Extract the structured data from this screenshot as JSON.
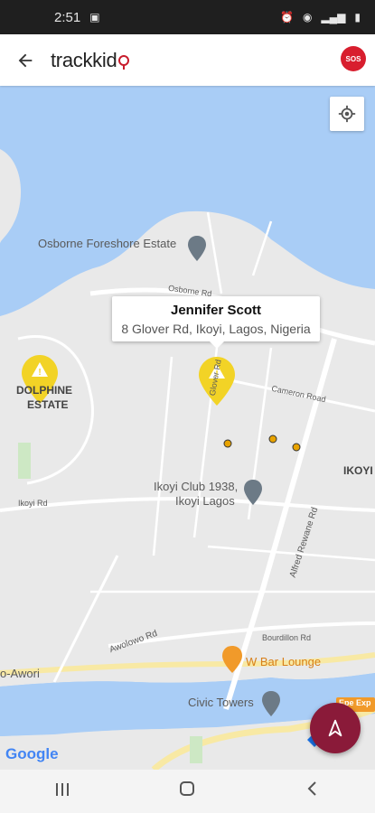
{
  "status_bar": {
    "time": "2:51"
  },
  "app_bar": {
    "logo_text": "trackkid",
    "sos_label": "SOS"
  },
  "map": {
    "labels": {
      "osborne": "Osborne Foreshore Estate",
      "dolphine_1": "DOLPHINE",
      "dolphine_2": "ESTATE",
      "ikoyi": "IKOYI",
      "ikoyi_club_1": "Ikoyi Club 1938,",
      "ikoyi_club_2": "Ikoyi Lagos",
      "wbar": "W Bar Lounge",
      "civic": "Civic Towers",
      "awori": "o-Awori",
      "alfred": "Alfred Rewane Rd",
      "cameron": "Cameron Road",
      "glover": "Glover Rd",
      "awolowo": "Awolowo Rd",
      "bourdillon": "Bourdillon Rd",
      "osborne_rd": "Osborne Rd",
      "ikoyi_rd": "Ikoyi Rd",
      "epe": "Epe Exp"
    },
    "info_window": {
      "name": "Jennifer Scott",
      "address": "8 Glover Rd, Ikoyi, Lagos, Nigeria"
    },
    "google_logo": "Google"
  },
  "colors": {
    "water": "#a9cdf6",
    "land": "#e9e9e9",
    "road": "#ffffff",
    "marker": "#f2d326",
    "sos": "#d81e2e",
    "fab": "#8a1a39",
    "highway": "#f8e9a4"
  }
}
